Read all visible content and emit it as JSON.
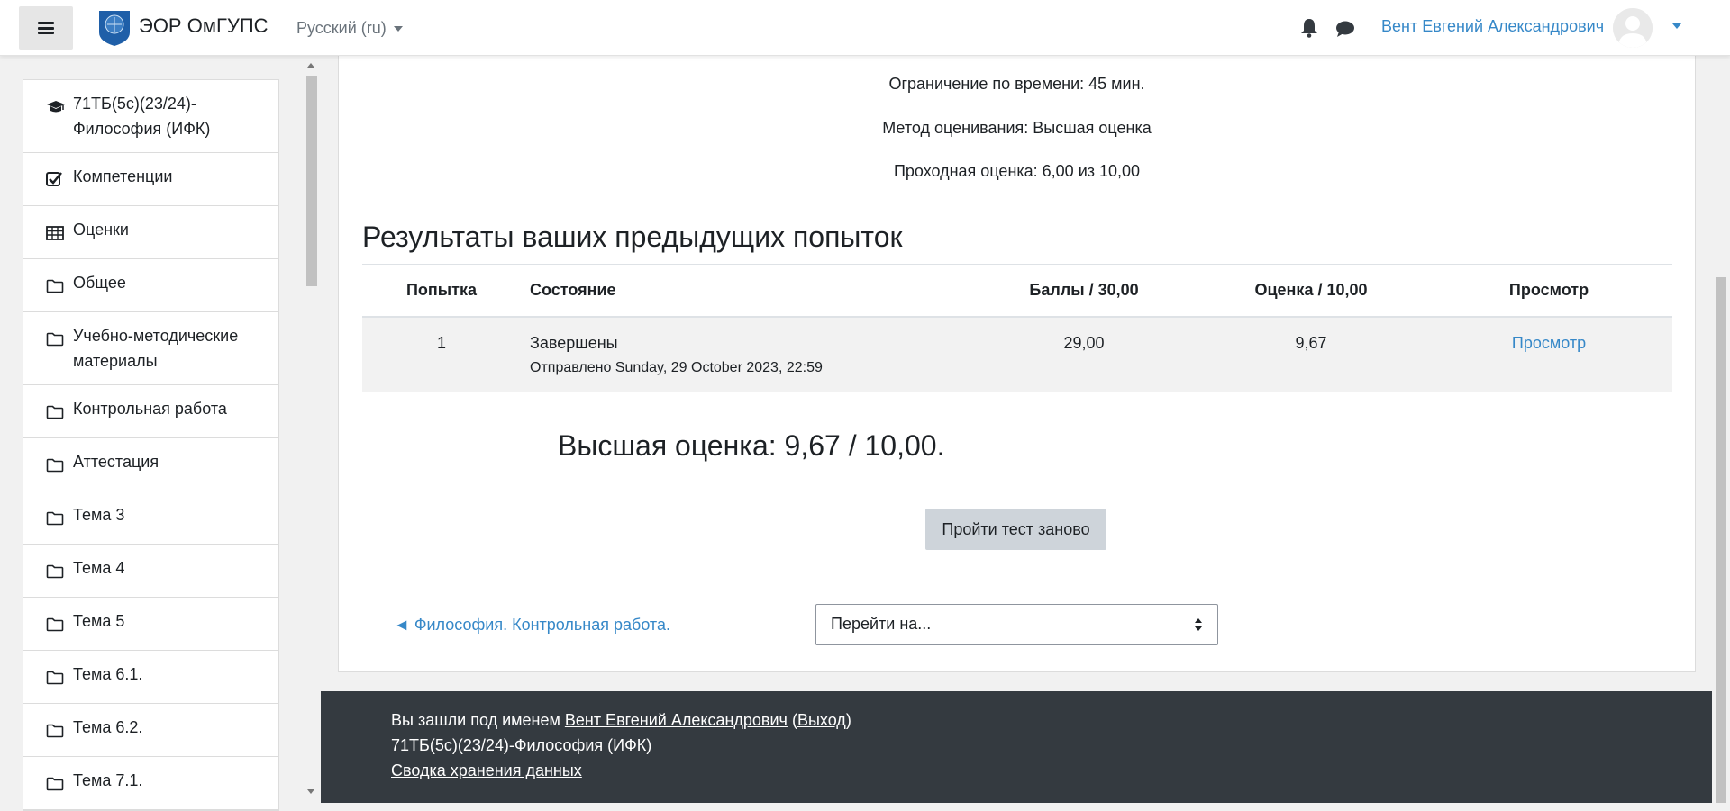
{
  "navbar": {
    "site_name": "ЭОР ОмГУПС",
    "language": "Русский (ru)",
    "user_name": "Вент Евгений Александрович"
  },
  "drawer": {
    "items": [
      {
        "label": "71ТБ(5с)(23/24)-\nФилософия (ИФК)",
        "icon": "graduation-cap-icon"
      },
      {
        "label": "Компетенции",
        "icon": "checkbox-icon"
      },
      {
        "label": "Оценки",
        "icon": "table-icon"
      },
      {
        "label": "Общее",
        "icon": "folder-icon"
      },
      {
        "label": "Учебно-методические\nматериалы",
        "icon": "folder-icon"
      },
      {
        "label": "Контрольная работа",
        "icon": "folder-icon"
      },
      {
        "label": "Аттестация",
        "icon": "folder-icon"
      },
      {
        "label": "Тема 3",
        "icon": "folder-icon"
      },
      {
        "label": "Тема 4",
        "icon": "folder-icon"
      },
      {
        "label": "Тема 5",
        "icon": "folder-icon"
      },
      {
        "label": "Тема 6.1.",
        "icon": "folder-icon"
      },
      {
        "label": "Тема 6.2.",
        "icon": "folder-icon"
      },
      {
        "label": "Тема 7.1.",
        "icon": "folder-icon"
      }
    ]
  },
  "quiz": {
    "time_limit": "Ограничение по времени: 45 мин.",
    "grading_method": "Метод оценивания: Высшая оценка",
    "passing_grade": "Проходная оценка: 6,00 из 10,00",
    "results_title": "Результаты ваших предыдущих попыток",
    "columns": [
      "Попытка",
      "Состояние",
      "Баллы / 30,00",
      "Оценка / 10,00",
      "Просмотр"
    ],
    "attempts": [
      {
        "number": "1",
        "state": "Завершены",
        "submitted": "Отправлено Sunday, 29 October 2023, 22:59",
        "marks": "29,00",
        "grade": "9,67",
        "review": "Просмотр"
      }
    ],
    "highest_grade": "Высшая оценка: 9,67 / 10,00.",
    "retry_button": "Пройти тест заново",
    "prev_activity": "◄ Философия. Контрольная работа.",
    "jump_to": "Перейти на..."
  },
  "footer": {
    "logged_in_prefix": "Вы зашли под именем",
    "user_link": "Вент Евгений Александрович",
    "logout_open": "(",
    "logout": "Выход",
    "logout_close": ")",
    "course_link": "71ТБ(5с)(23/24)-Философия (ИФК)",
    "data_retention": "Сводка хранения данных"
  }
}
